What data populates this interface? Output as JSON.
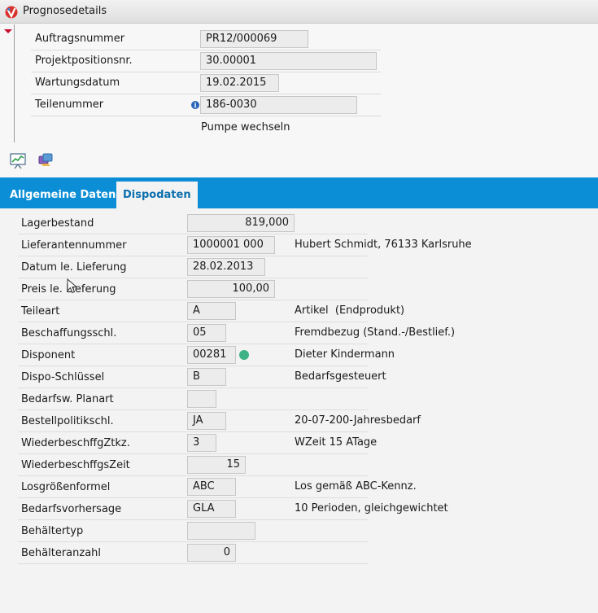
{
  "window": {
    "title": "Prognosedetails"
  },
  "header": {
    "auftragsnummer": {
      "label": "Auftragsnummer",
      "value": "PR12/000069"
    },
    "projektposition": {
      "label": "Projektpositionsnr.",
      "value": "30.00001"
    },
    "wartungsdatum": {
      "label": "Wartungsdatum",
      "value": "19.02.2015"
    },
    "teilenummer": {
      "label": "Teilenummer",
      "value": "186-0030",
      "description": "Pumpe wechseln"
    }
  },
  "tabs": [
    {
      "label": "Allgemeine Daten",
      "active": false
    },
    {
      "label": "Dispodaten",
      "active": true
    }
  ],
  "dispo": {
    "lagerbestand": {
      "label": "Lagerbestand",
      "value": "819,000"
    },
    "lieferantennummer": {
      "label": "Lieferantennummer",
      "value": "1000001 000",
      "info": "Hubert Schmidt, 76133 Karlsruhe"
    },
    "datum_lieferung": {
      "label": "Datum le. Lieferung",
      "value": "28.02.2013"
    },
    "preis_lieferung": {
      "label": "Preis le. Lieferung",
      "value": "100,00"
    },
    "teileart": {
      "label": "Teileart",
      "value": "A",
      "info": "Artikel  (Endprodukt)"
    },
    "beschaffungsschl": {
      "label": "Beschaffungsschl.",
      "value": "05",
      "info": "Fremdbezug (Stand.-/Bestlief.)"
    },
    "disponent": {
      "label": "Disponent",
      "value": "00281",
      "info": "Dieter Kindermann"
    },
    "dispo_schluessel": {
      "label": "Dispo-Schlüssel",
      "value": "B",
      "info": "Bedarfsgesteuert"
    },
    "bedarfsw_planart": {
      "label": "Bedarfsw. Planart",
      "value": ""
    },
    "bestellpolitikschl": {
      "label": "Bestellpolitikschl.",
      "value": "JA",
      "info": "20-07-200-Jahresbedarf"
    },
    "wiederbeschffg_ztkz": {
      "label": "WiederbeschffgZtkz.",
      "value": "3",
      "info": "WZeit 15 ATage"
    },
    "wiederbeschffgs_zeit": {
      "label": "WiederbeschffgsZeit",
      "value": "15"
    },
    "losgroessenformel": {
      "label": "Losgrößenformel",
      "value": "ABC",
      "info": "Los gemäß ABC-Kennz."
    },
    "bedarfsvorhersage": {
      "label": "Bedarfsvorhersage",
      "value": "GLA",
      "info": "10 Perioden, gleichgewichtet"
    },
    "behaeltertyp": {
      "label": "Behältertyp",
      "value": ""
    },
    "behaelteranzahl": {
      "label": "Behälteranzahl",
      "value": "0"
    }
  },
  "colors": {
    "tab_bar": "#0b8ed6",
    "active_tab_text": "#0b6fae",
    "status_dot": "#3db284",
    "collapse_arrow": "#c8102e"
  },
  "icons": {
    "app": "app-logo-icon",
    "chart": "chart-icon",
    "export": "export-icon",
    "info": "info-icon"
  }
}
